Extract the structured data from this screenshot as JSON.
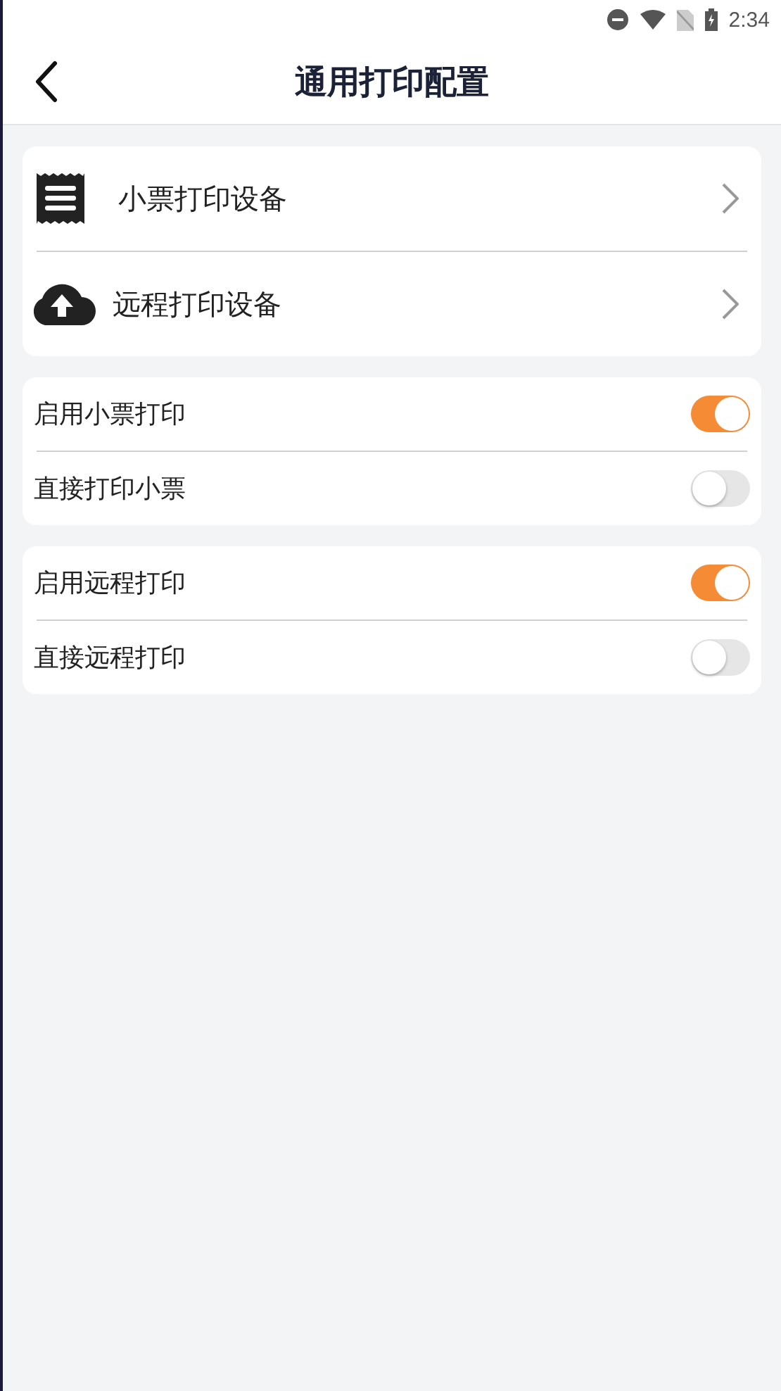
{
  "status_bar": {
    "time": "2:34"
  },
  "header": {
    "title": "通用打印配置"
  },
  "devices": [
    {
      "kind": "receipt",
      "label": "小票打印设备"
    },
    {
      "kind": "cloud",
      "label": "远程打印设备"
    }
  ],
  "switch_groups": [
    [
      {
        "label": "启用小票打印",
        "on": true
      },
      {
        "label": "直接打印小票",
        "on": false
      }
    ],
    [
      {
        "label": "启用远程打印",
        "on": true
      },
      {
        "label": "直接远程打印",
        "on": false
      }
    ]
  ]
}
